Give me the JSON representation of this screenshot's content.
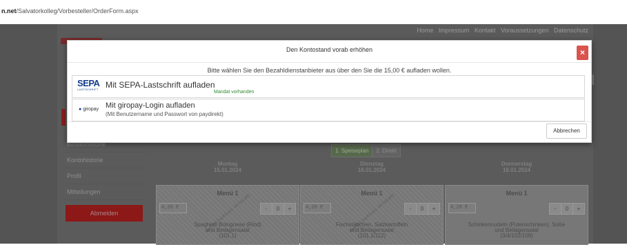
{
  "browser": {
    "url_host": "n.net",
    "url_path": "/Salvatorkolleg/Vorbesteller/OrderForm.aspx"
  },
  "topnav": [
    "Home",
    "Impressum",
    "Kontakt",
    "Voraussetzungen",
    "Datenschutz"
  ],
  "sidebar": {
    "items": [
      "Bestellhistorie",
      "Kontohistorie",
      "Profil",
      "Mitteilungen"
    ],
    "logout_label": "Abmelden"
  },
  "tabs": [
    "1. Speiseplan",
    "2. Direkt"
  ],
  "days": [
    {
      "name": "Montag",
      "date": "15.01.2024"
    },
    {
      "name": "Dienstag",
      "date": "16.01.2024"
    },
    {
      "name": "Donnerstag",
      "date": "18.01.2024"
    }
  ],
  "menus": [
    {
      "title": "Menü 1",
      "price": "4,20 €",
      "minus": "-",
      "qty": "0",
      "plus": "+",
      "stamp": "Bestellschluss erreicht",
      "desc_lines": [
        "Spaghetti Bolognese (Rind)",
        "und Beilagensalat",
        "(101.1)"
      ]
    },
    {
      "title": "Menü 1",
      "price": "4,20 €",
      "minus": "-",
      "qty": "0",
      "plus": "+",
      "stamp": "Bestellschluss erreicht",
      "desc_lines": [
        "Fischstäbchen, Salzkartoffeln",
        "und Beilagensalat",
        "(101.1/112)"
      ]
    },
    {
      "title": "Menü 1",
      "price": "4,20 €",
      "minus": "-",
      "qty": "0",
      "plus": "+",
      "stamp": "",
      "desc_lines": [
        "Schinkennudeln (Putenschinken), Soße",
        "und Beilagensalat",
        "(3/4/102/109)"
      ]
    }
  ],
  "modal": {
    "title": "Den Kontostand vorab erhöhen",
    "close_symbol": "×",
    "instruction": "Bitte wählen Sie den Bezahldienstanbieter aus über den Sie die 15,00 € aufladen wollen.",
    "options": [
      {
        "logo": "SEPA",
        "logo_sub": "LASTSCHRIFT",
        "title": "Mit SEPA-Lastschrift aufladen",
        "note": "Mandat vorhanden"
      },
      {
        "logo": "giropay",
        "title": "Mit giropay-Login aufladen",
        "subtitle": "(Mit Benutzername und Passwort von paydirekt)"
      }
    ],
    "cancel_label": "Abbrechen"
  },
  "colors": {
    "close_button": "#d9534f",
    "mandat_text": "#2f8a2f",
    "sepa_blue": "#133d8d",
    "sepa_yellow": "#e8a31c",
    "logout_button": "#8c1818"
  }
}
